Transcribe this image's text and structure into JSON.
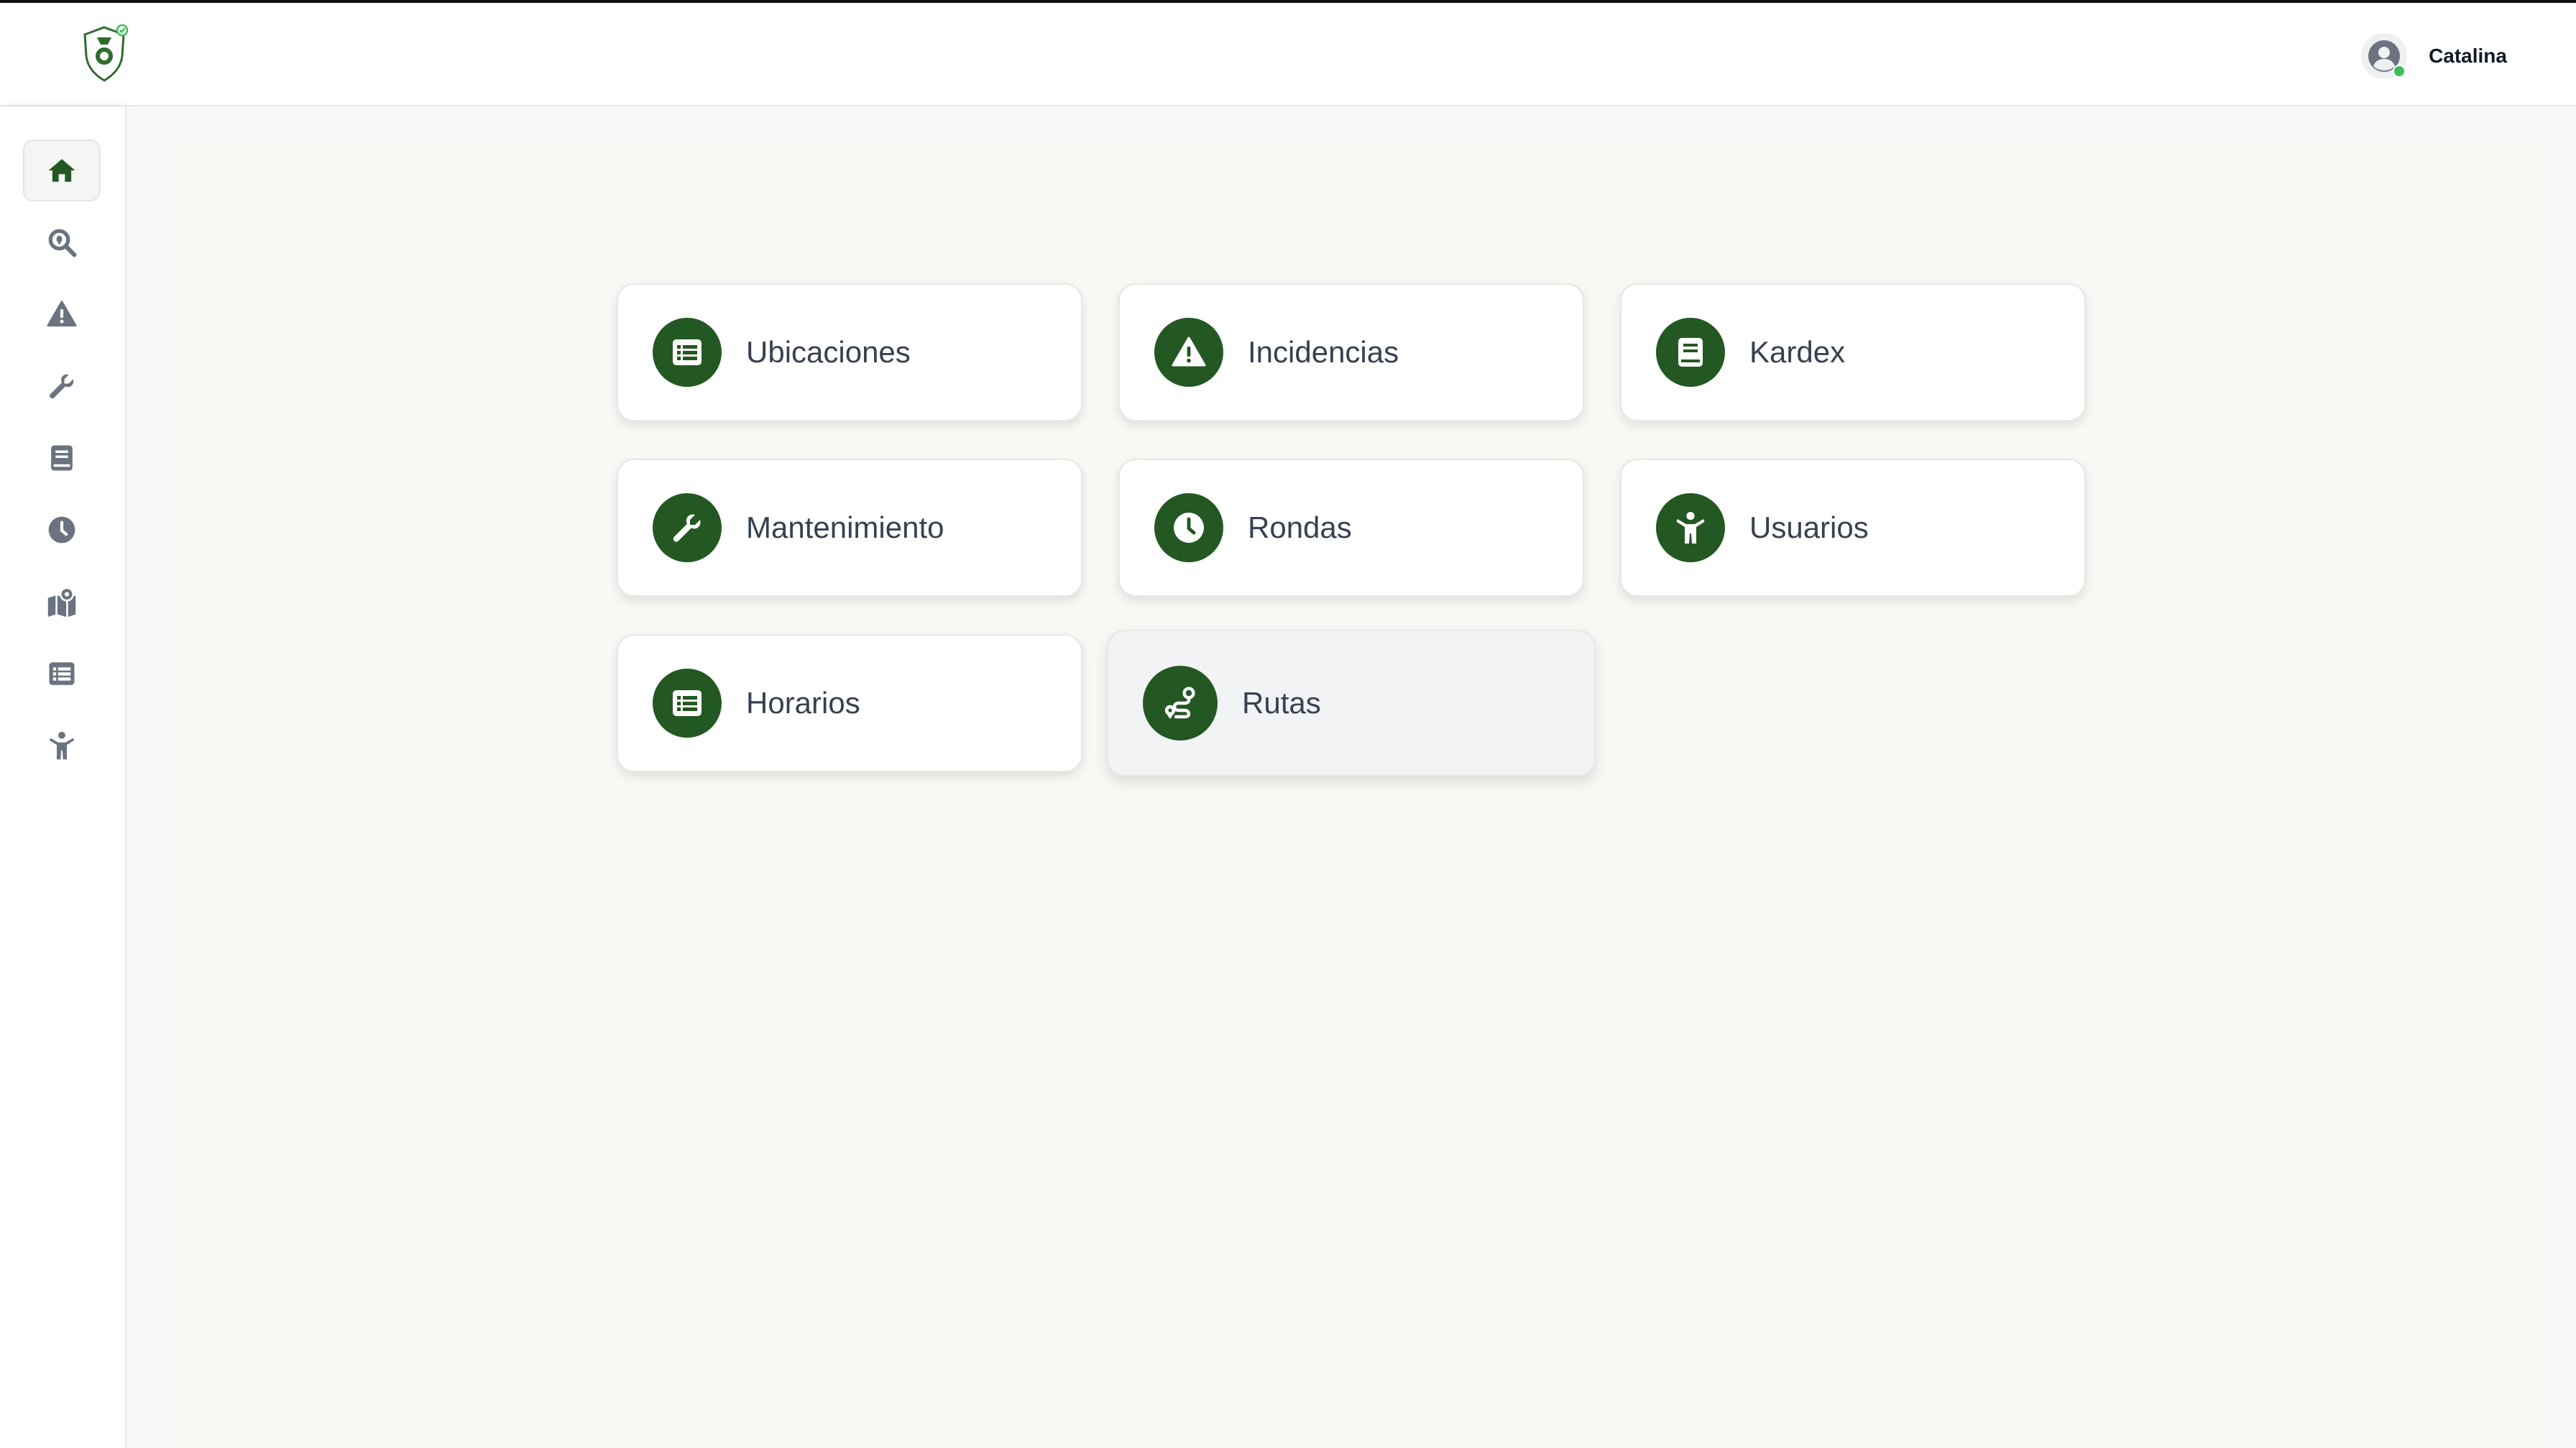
{
  "header": {
    "user": {
      "name": "Catalina",
      "status": "online"
    }
  },
  "colors": {
    "brand_green": "#245822",
    "icon_gray": "#6b7280",
    "online": "#3cbc5a"
  },
  "sidebar": {
    "items": [
      {
        "id": "home",
        "icon": "home-icon",
        "active": true
      },
      {
        "id": "search",
        "icon": "search-location-icon"
      },
      {
        "id": "incidents",
        "icon": "warning-icon"
      },
      {
        "id": "maintenance",
        "icon": "wrench-icon"
      },
      {
        "id": "kardex",
        "icon": "book-icon"
      },
      {
        "id": "rounds",
        "icon": "clock-icon"
      },
      {
        "id": "map",
        "icon": "map-location-icon"
      },
      {
        "id": "list",
        "icon": "list-icon"
      },
      {
        "id": "users",
        "icon": "person-icon"
      }
    ]
  },
  "cards": [
    {
      "label": "Ubicaciones",
      "icon": "list-icon"
    },
    {
      "label": "Incidencias",
      "icon": "warning-icon"
    },
    {
      "label": "Kardex",
      "icon": "book-icon"
    },
    {
      "label": "Mantenimiento",
      "icon": "wrench-icon"
    },
    {
      "label": "Rondas",
      "icon": "clock-icon"
    },
    {
      "label": "Usuarios",
      "icon": "person-icon"
    },
    {
      "label": "Horarios",
      "icon": "list-icon"
    },
    {
      "label": "Rutas",
      "icon": "route-icon",
      "hovered": true
    }
  ]
}
